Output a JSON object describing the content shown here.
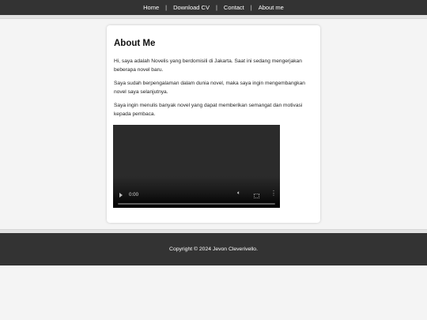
{
  "nav": {
    "items": [
      "Home",
      "Download CV",
      "Contact",
      "About me"
    ],
    "separator": "|"
  },
  "about": {
    "title": "About Me",
    "paragraphs": [
      "Hi, saya adalah Novelis yang berdomisili di Jakarta. Saat ini sedang mengerjakan beberapa novel baru.",
      "Saya sudah berpengalaman dalam dunia novel, maka saya ingin mengembangkan novel saya selanjutnya.",
      "Saya ingin menulis banyak novel yang dapat memberikan semangat dan motivasi kepada pembaca."
    ]
  },
  "video": {
    "time": "0:00",
    "progress": 0,
    "icons": [
      "play-icon",
      "volume-icon",
      "fullscreen-icon",
      "more-options-icon"
    ]
  },
  "footer": {
    "copyright": "Copyright © 2024 Jevon Cleverivello."
  },
  "colors": {
    "nav_bg": "#333333",
    "page_bg": "#f4f4f4",
    "card_bg": "#ffffff",
    "footer_bg": "#333333"
  }
}
